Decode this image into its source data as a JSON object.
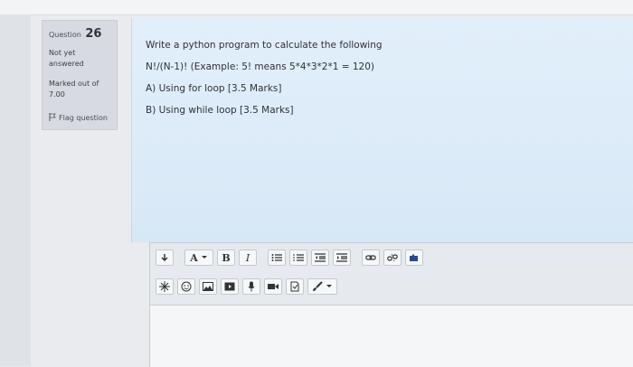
{
  "question": {
    "label": "Question",
    "number": "26",
    "status_line1": "Not yet",
    "status_line2": "answered",
    "marked_line1": "Marked out of",
    "marked_value": "7.00",
    "flag_label": "Flag question"
  },
  "question_text": {
    "line1": "Write a python program to calculate the following",
    "line2": "N!/(N-1)! (Example: 5! means 5*4*3*2*1 = 120)",
    "line3": "A) Using for loop [3.5 Marks]",
    "line4": "B) Using while loop [3.5 Marks]"
  },
  "toolbar": {
    "font_color_label": "A",
    "bold_label": "B",
    "italic_label": "I"
  },
  "colors": {
    "question_bg": "#dcebf8",
    "info_bg": "#d7dbe1"
  }
}
